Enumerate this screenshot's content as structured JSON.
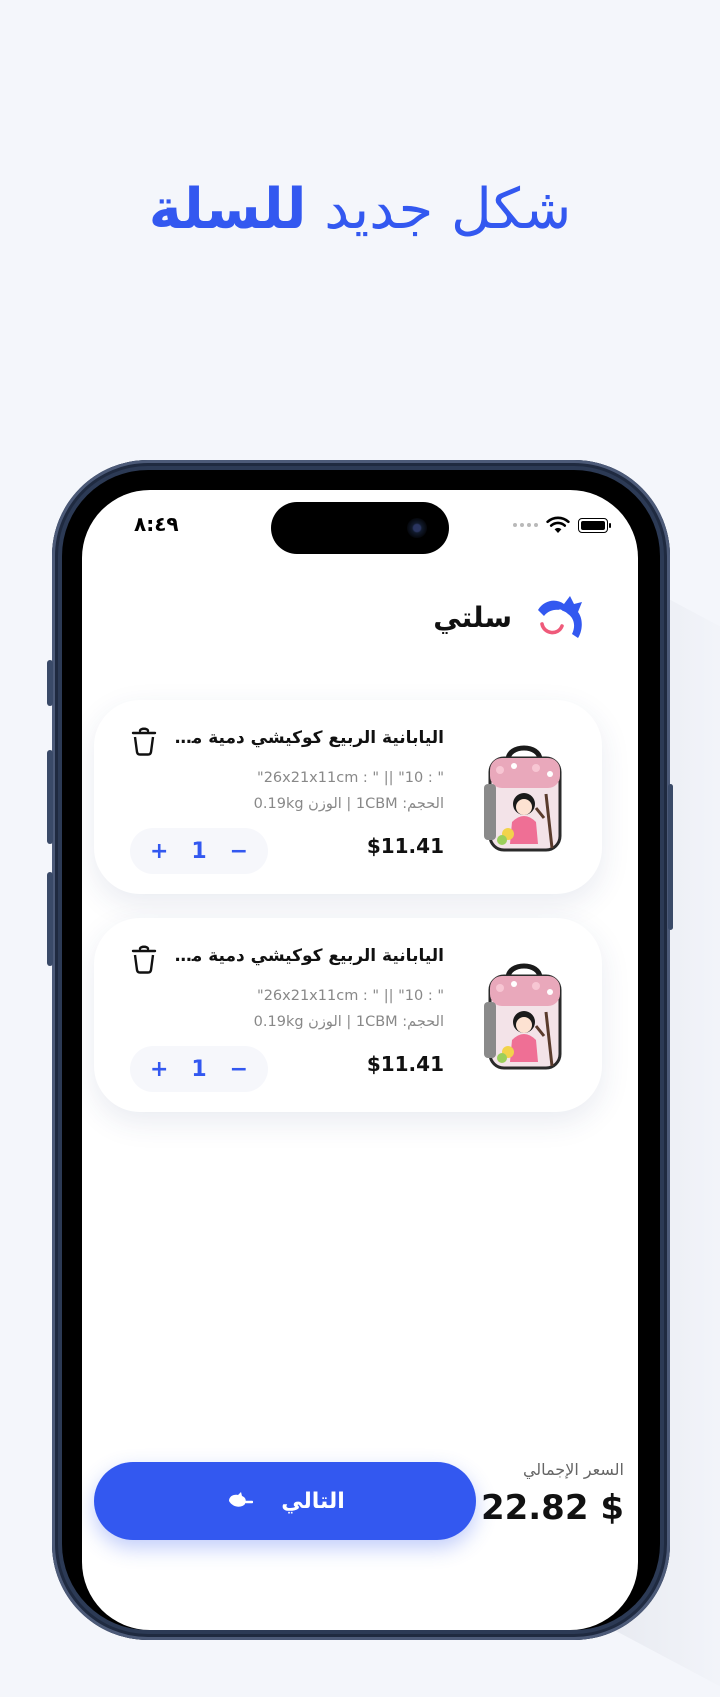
{
  "hero": {
    "title_regular": "شكل جديد",
    "title_bold": "للسلة"
  },
  "status_bar": {
    "time": "٨:٤٩"
  },
  "brand": {
    "name": "سلتي"
  },
  "cart": {
    "items": [
      {
        "title": "اليابانية الربيع كوكيشي دمية معدنية حقيبة الغداء",
        "spec_line1": "\" : 10\" || \" : 26x21x11cm\"",
        "spec_line2": "الحجم: 1CBM | الوزن 0.19kg",
        "price": "$11.41",
        "quantity": "1",
        "plus": "+",
        "minus": "−"
      },
      {
        "title": "اليابانية الربيع كوكيشي دمية معدنية حقيبة الغداء",
        "spec_line1": "\" : 10\" || \" : 26x21x11cm\"",
        "spec_line2": "الحجم: 1CBM | الوزن 0.19kg",
        "price": "$11.41",
        "quantity": "1",
        "plus": "+",
        "minus": "−"
      }
    ]
  },
  "footer": {
    "total_label": "السعر الإجمالي",
    "total_value": "22.82 $",
    "next_label": "التالي"
  },
  "colors": {
    "accent": "#3358f0",
    "background": "#f4f6fb",
    "card": "#ffffff",
    "brand_smile": "#ef5a7a"
  }
}
